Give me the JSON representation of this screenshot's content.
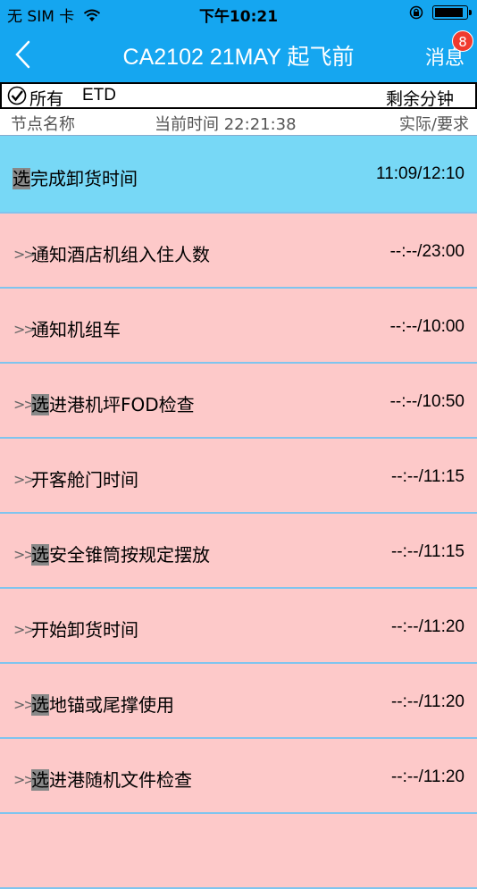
{
  "status_bar": {
    "carrier": "无 SIM 卡",
    "time": "下午10:21",
    "battery_level": 0.9
  },
  "nav": {
    "back_icon": "chevron-left-icon",
    "title": "CA2102 21MAY 起飞前",
    "messages_label": "消息",
    "messages_badge": "8"
  },
  "filter": {
    "checked": true,
    "all_label": "所有",
    "etd_label": "ETD",
    "remaining_label": "剩余分钟"
  },
  "columns": {
    "node_name": "节点名称",
    "current_time": "当前时间 22:21:38",
    "actual_required": "实际/要求"
  },
  "colors": {
    "nav_blue": "#15a6f0",
    "active_row": "#77d8f6",
    "pending_row": "#fdc9c9",
    "badge_red": "#f03a2e"
  },
  "items": [
    {
      "prefix": "选",
      "text": "完成卸货时间",
      "time": "11:09/12:10",
      "arrows": ""
    },
    {
      "prefix": "",
      "text": "通知酒店机组入住人数",
      "time": "--:--/23:00",
      "arrows": ">>"
    },
    {
      "prefix": "",
      "text": "通知机组车",
      "time": "--:--/10:00",
      "arrows": ">>"
    },
    {
      "prefix": "选",
      "text": "进港机坪FOD检查",
      "time": "--:--/10:50",
      "arrows": ">>"
    },
    {
      "prefix": "",
      "text": "开客舱门时间",
      "time": "--:--/11:15",
      "arrows": ">>"
    },
    {
      "prefix": "选",
      "text": "安全锥筒按规定摆放",
      "time": "--:--/11:15",
      "arrows": ">>"
    },
    {
      "prefix": "",
      "text": "开始卸货时间",
      "time": "--:--/11:20",
      "arrows": ">>"
    },
    {
      "prefix": "选",
      "text": "地锚或尾撑使用",
      "time": "--:--/11:20",
      "arrows": ">>"
    },
    {
      "prefix": "选",
      "text": "进港随机文件检查",
      "time": "--:--/11:20",
      "arrows": ">>"
    },
    {
      "prefix": "",
      "text": "",
      "time": "",
      "arrows": ""
    }
  ]
}
